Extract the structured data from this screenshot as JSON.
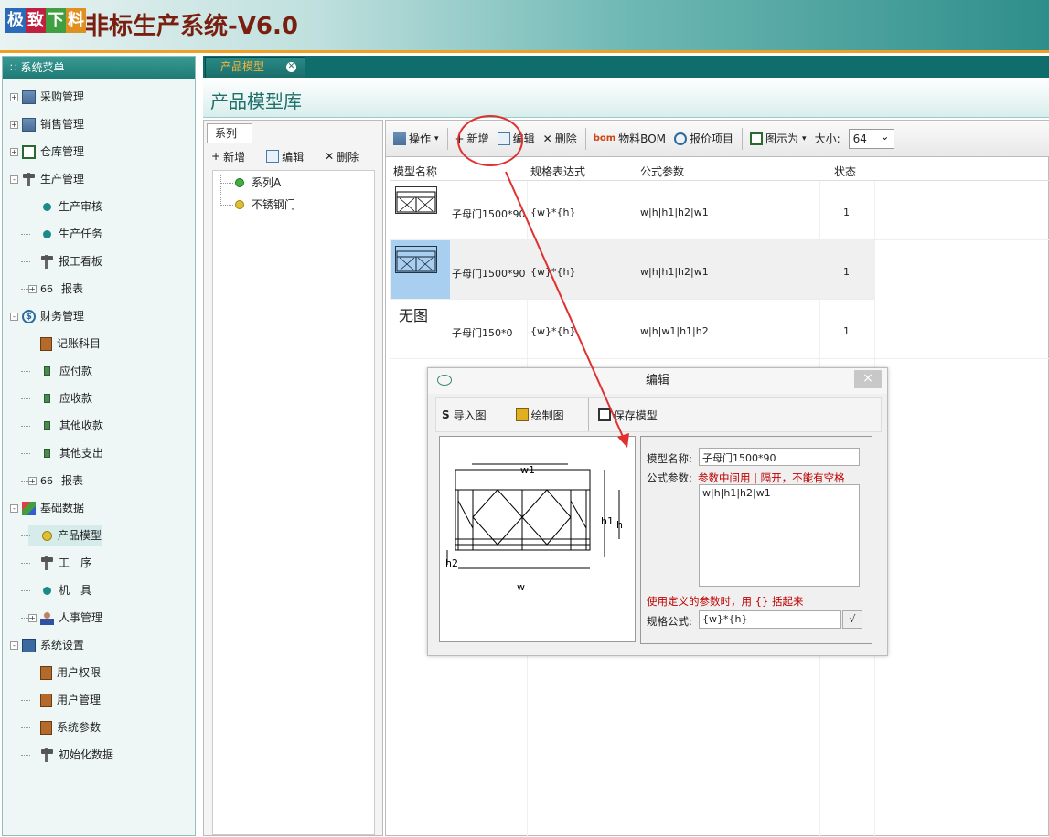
{
  "app": {
    "logo_chars": [
      "极",
      "致",
      "下",
      "料"
    ],
    "logo_colors": [
      "#2a6ab8",
      "#c02040",
      "#40a040",
      "#e09020"
    ],
    "title": "非标生产系统-V6.0"
  },
  "sidebar": {
    "header": "系统菜单",
    "items": [
      {
        "label": "采购管理",
        "level": 0,
        "icon": "building-icon",
        "expander": "+"
      },
      {
        "label": "销售管理",
        "level": 0,
        "icon": "building-icon",
        "expander": "+"
      },
      {
        "label": "仓库管理",
        "level": 0,
        "icon": "warehouse-icon",
        "expander": "+"
      },
      {
        "label": "生产管理",
        "level": 0,
        "icon": "hammer-icon",
        "expander": "-"
      },
      {
        "label": "生产审核",
        "level": 1,
        "icon": "dot-icon"
      },
      {
        "label": "生产任务",
        "level": 1,
        "icon": "dot-icon"
      },
      {
        "label": "报工看板",
        "level": 1,
        "icon": "hammer-icon"
      },
      {
        "label": "报表",
        "level": 1,
        "icon": "glasses-icon",
        "expander": "+"
      },
      {
        "label": "财务管理",
        "level": 0,
        "icon": "dollar-icon",
        "expander": "-"
      },
      {
        "label": "记账科目",
        "level": 1,
        "icon": "book-icon"
      },
      {
        "label": "应付款",
        "level": 1,
        "icon": "doc-icon"
      },
      {
        "label": "应收款",
        "level": 1,
        "icon": "doc-icon"
      },
      {
        "label": "其他收款",
        "level": 1,
        "icon": "doc-icon"
      },
      {
        "label": "其他支出",
        "level": 1,
        "icon": "doc-icon"
      },
      {
        "label": "报表",
        "level": 1,
        "icon": "glasses-icon",
        "expander": "+"
      },
      {
        "label": "基础数据",
        "level": 0,
        "icon": "shapes-icon",
        "expander": "-"
      },
      {
        "label": "产品模型",
        "level": 1,
        "icon": "yellow-dot-icon",
        "selected": true
      },
      {
        "label": "工　序",
        "level": 1,
        "icon": "hammer-icon"
      },
      {
        "label": "机　具",
        "level": 1,
        "icon": "dot-icon"
      },
      {
        "label": "人事管理",
        "level": 1,
        "icon": "person-icon",
        "expander": "+"
      },
      {
        "label": "系统设置",
        "level": 0,
        "icon": "computer-icon",
        "expander": "-"
      },
      {
        "label": "用户权限",
        "level": 1,
        "icon": "book-icon"
      },
      {
        "label": "用户管理",
        "level": 1,
        "icon": "book-icon"
      },
      {
        "label": "系统参数",
        "level": 1,
        "icon": "book-icon"
      },
      {
        "label": "初始化数据",
        "level": 1,
        "icon": "hammer-icon"
      }
    ]
  },
  "main": {
    "tab": "产品模型",
    "page_title": "产品模型库",
    "series": {
      "tab": "系列",
      "toolbar": {
        "add": "新增",
        "edit": "编辑",
        "delete": "删除"
      },
      "items": [
        {
          "label": "系列A",
          "color": "#40b040"
        },
        {
          "label": "不锈钢门",
          "color": "#e0c030"
        }
      ]
    },
    "toolbar": {
      "operate": "操作",
      "add": "新增",
      "edit": "编辑",
      "delete": "删除",
      "bom": "物料BOM",
      "quote": "报价项目",
      "display": "图示为",
      "size_label": "大小:",
      "size_value": "64"
    },
    "grid": {
      "columns": [
        "模型名称",
        "规格表达式",
        "公式参数",
        "状态"
      ],
      "rows": [
        {
          "name": "子母门1500*90",
          "spec": "{w}*{h}",
          "params": "w|h|h1|h2|w1",
          "status": "1",
          "image": "door-thumbnail"
        },
        {
          "name": "子母门1500*90",
          "spec": "{w}*{h}",
          "params": "w|h|h1|h2|w1",
          "status": "1",
          "image": "door-thumbnail",
          "selected": true
        },
        {
          "name": "子母门150*0",
          "spec": "{w}*{h}",
          "params": "w|h|w1|h1|h2",
          "status": "1",
          "image": "无图"
        }
      ]
    }
  },
  "dialog": {
    "title": "编辑",
    "close": "×",
    "toolbar": {
      "import": "导入图",
      "draw": "绘制图",
      "save": "保存模型"
    },
    "drawing_labels": {
      "w1": "w1",
      "h1": "h1",
      "h": "h",
      "h2": "h2",
      "w": "w"
    },
    "form": {
      "name_label": "模型名称:",
      "name_value": "子母门1500*90",
      "params_label": "公式参数:",
      "params_hint": "参数中间用 | 隔开，不能有空格",
      "params_value": "w|h|h1|h2|w1",
      "def_hint": "使用定义的参数时，用 {} 括起来",
      "spec_label": "规格公式:",
      "spec_value": "{w}*{h}",
      "check_btn": "√"
    }
  },
  "annotation": {
    "color": "#e03030"
  }
}
